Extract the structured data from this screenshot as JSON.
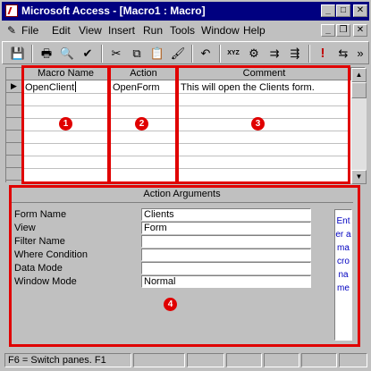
{
  "window": {
    "title": "Microsoft Access - [Macro1 : Macro]",
    "controls": {
      "minimize": "_",
      "maximize": "□",
      "close": "✕"
    }
  },
  "menu": {
    "items": [
      "File",
      "Edit",
      "View",
      "Insert",
      "Run",
      "Tools",
      "Window",
      "Help"
    ],
    "mdi_controls": {
      "minimize": "_",
      "restore": "❐",
      "close": "✕"
    }
  },
  "toolbar": {
    "buttons": [
      {
        "name": "save-icon",
        "glyph": "💾"
      },
      {
        "name": "print-icon",
        "glyph": "🖶"
      },
      {
        "name": "print-preview-icon",
        "glyph": "🔍"
      },
      {
        "name": "spelling-icon",
        "glyph": "✔"
      },
      {
        "name": "cut-icon",
        "glyph": "✂"
      },
      {
        "name": "copy-icon",
        "glyph": "⧉"
      },
      {
        "name": "paste-icon",
        "glyph": "📋"
      },
      {
        "name": "format-painter-icon",
        "glyph": "🖌"
      },
      {
        "name": "undo-icon",
        "glyph": "↶"
      },
      {
        "name": "macro-names-icon",
        "glyph": "XYZ"
      },
      {
        "name": "conditions-icon",
        "glyph": "⚙"
      },
      {
        "name": "insert-rows-icon",
        "glyph": "⇉"
      },
      {
        "name": "delete-rows-icon",
        "glyph": "⇶"
      },
      {
        "name": "run-icon",
        "glyph": "!"
      },
      {
        "name": "single-step-icon",
        "glyph": "⇆"
      },
      {
        "name": "more-buttons-icon",
        "glyph": "»"
      }
    ]
  },
  "grid": {
    "columns": [
      "Macro Name",
      "Action",
      "Comment"
    ],
    "rows": [
      {
        "macro_name": "OpenClient",
        "action": "OpenForm",
        "comment": "This will open the Clients form."
      }
    ],
    "current_row_marker": "▶"
  },
  "annotations": [
    "1",
    "2",
    "3",
    "4"
  ],
  "action_arguments": {
    "title": "Action Arguments",
    "fields": [
      {
        "label": "Form Name",
        "value": "Clients"
      },
      {
        "label": "View",
        "value": "Form"
      },
      {
        "label": "Filter Name",
        "value": ""
      },
      {
        "label": "Where Condition",
        "value": ""
      },
      {
        "label": "Data Mode",
        "value": ""
      },
      {
        "label": "Window Mode",
        "value": "Normal"
      }
    ],
    "help_text": "Enter a macro name"
  },
  "status": {
    "text": "F6 = Switch panes.  F1"
  },
  "colors": {
    "annotation_red": "#e00000",
    "title_bar": "#000080",
    "help_text": "#0000c0"
  }
}
